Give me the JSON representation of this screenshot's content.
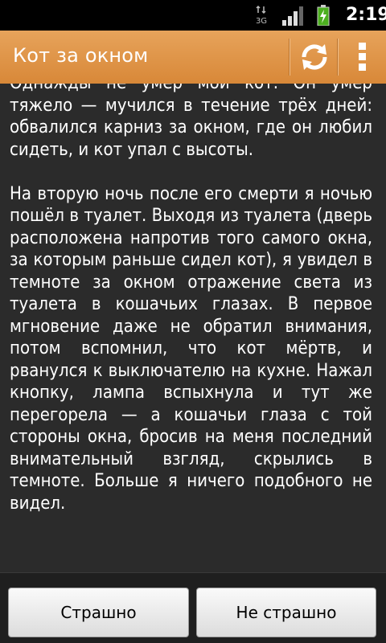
{
  "status_bar": {
    "network_label": "3G",
    "time": "2:19",
    "icons": [
      "data-arrows-icon",
      "signal-icon",
      "battery-charging-icon"
    ]
  },
  "action_bar": {
    "title": "Кот за окном",
    "actions": [
      "refresh-icon",
      "overflow-menu-icon"
    ],
    "accent_color": "#d88838"
  },
  "story": {
    "paragraphs": [
      "Однажды не умер мой кот. Он умер тяжело — мучился в течение трёх дней: обвалился карниз за окном, где он любил сидеть, и кот упал с высоты.",
      "На вторую ночь после его смерти я ночью пошёл в туалет. Выходя из туалета (дверь расположена напротив того самого окна, за которым раньше сидел кот), я увидел в темноте за окном отражение света из туалета в кошачьих глазах. В первое мгновение даже не обратил внимания, потом вспомнил, что кот мёртв, и рванулся к выключателю на кухне. Нажал кнопку, лампа вспыхнула и тут же перегорела — а кошачьи глаза с той стороны окна, бросив на меня последний внимательный взгляд, скрылись в темноте. Больше я ничего подобного не видел."
    ]
  },
  "buttons": {
    "scary": "Страшно",
    "not_scary": "Не страшно"
  }
}
